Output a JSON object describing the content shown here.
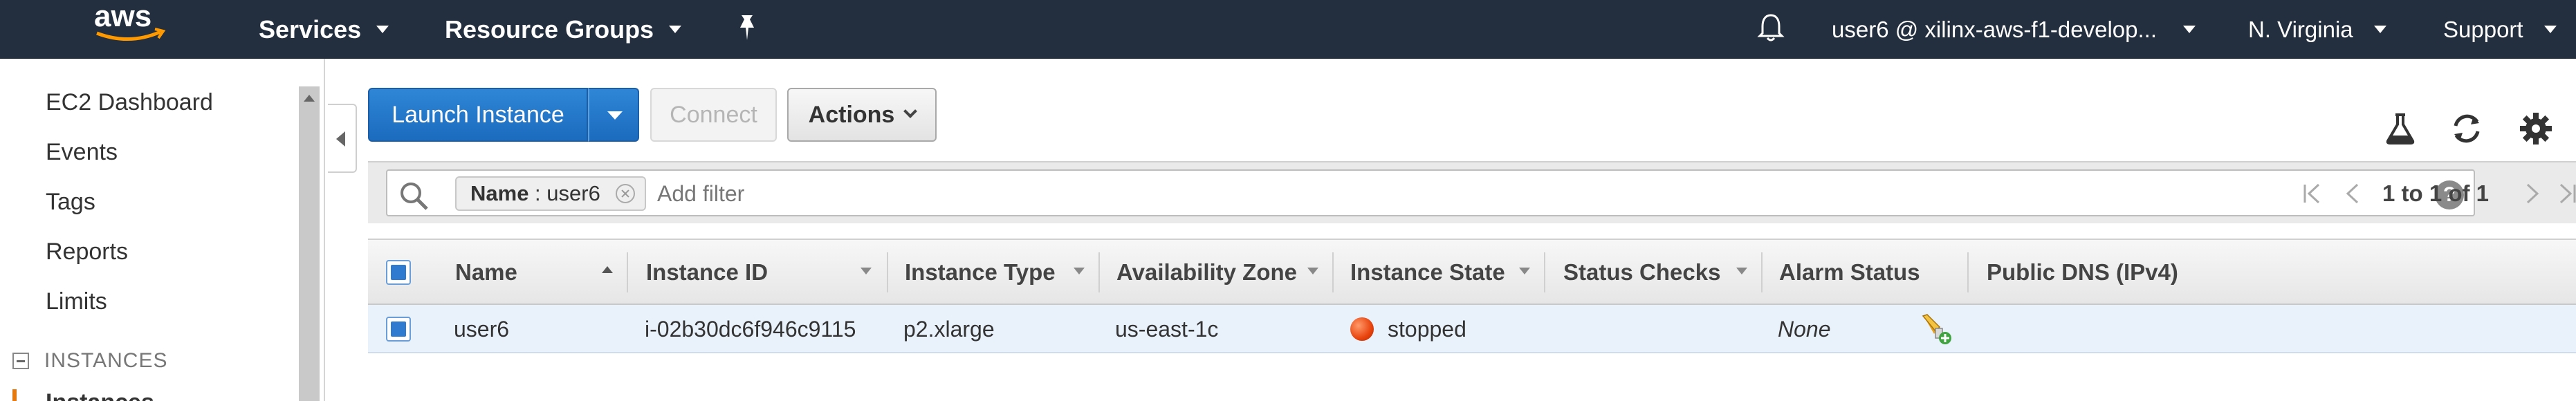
{
  "colors": {
    "nav_bg": "#232f3e",
    "primary": "#1b6bbf",
    "row_selected": "#e9f1fb",
    "state_stopped": "#e8430d",
    "accent": "#e47911"
  },
  "topnav": {
    "logo_text": "aws",
    "services": "Services",
    "resource_groups": "Resource Groups",
    "pin_icon": "pin-icon",
    "bell_icon": "bell-icon",
    "account": "user6 @ xilinx-aws-f1-develop...",
    "region": "N. Virginia",
    "support": "Support"
  },
  "sidebar": {
    "items": [
      {
        "label": "EC2 Dashboard"
      },
      {
        "label": "Events"
      },
      {
        "label": "Tags"
      },
      {
        "label": "Reports"
      },
      {
        "label": "Limits"
      }
    ],
    "section": "INSTANCES",
    "current": "Instances"
  },
  "toolbar": {
    "launch": "Launch Instance",
    "connect": "Connect",
    "actions": "Actions",
    "icons": [
      "flask-icon",
      "refresh-icon",
      "gear-icon"
    ]
  },
  "filter": {
    "token_key": "Name",
    "token_sep": " : ",
    "token_value": "user6",
    "placeholder": "Add filter",
    "help": "?",
    "pager_text": "1 to 1 of 1"
  },
  "table": {
    "columns": [
      "Name",
      "Instance ID",
      "Instance Type",
      "Availability Zone",
      "Instance State",
      "Status Checks",
      "Alarm Status",
      "Public DNS (IPv4)"
    ],
    "rows": [
      {
        "name": "user6",
        "instance_id": "i-02b30dc6f946c9115",
        "instance_type": "p2.xlarge",
        "availability_zone": "us-east-1c",
        "instance_state": "stopped",
        "status_checks": "",
        "alarm_status": "None",
        "public_dns": ""
      }
    ]
  }
}
